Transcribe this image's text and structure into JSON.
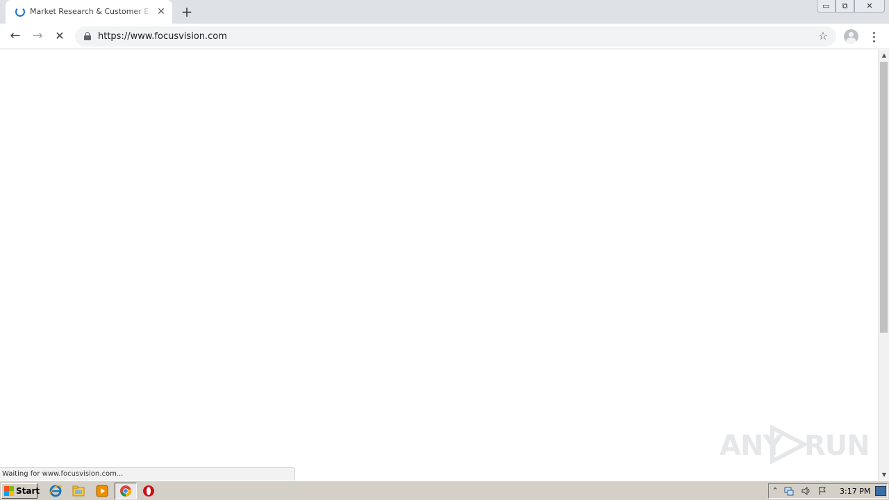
{
  "browser": {
    "tab": {
      "title": "Market Research & Customer Experience",
      "close_glyph": "✕",
      "loading_icon": "spinner-icon"
    },
    "new_tab_glyph": "+",
    "window_controls": {
      "minimize_glyph": "▭",
      "restore_glyph": "⧉",
      "close_glyph": "✕"
    },
    "toolbar": {
      "back_glyph": "←",
      "forward_glyph": "→",
      "stop_glyph": "✕",
      "url": "https://www.focusvision.com",
      "star_glyph": "☆"
    },
    "status_text": "Waiting for www.focusvision.com...",
    "scrollbar": {
      "up_glyph": "▲",
      "down_glyph": "▼"
    }
  },
  "watermark": {
    "left": "ANY",
    "right": "RUN"
  },
  "taskbar": {
    "start_label": "Start",
    "apps": [
      "internet-explorer",
      "windows-explorer",
      "media-player",
      "chrome",
      "opera"
    ],
    "tray": {
      "clock": "3:17 PM",
      "expand_glyph": "⌃"
    }
  },
  "colors": {
    "tab_strip": "#dee1e6",
    "omnibox": "#f1f3f4",
    "accent": "#1a73e8",
    "taskbar": "#d4d0c8"
  }
}
